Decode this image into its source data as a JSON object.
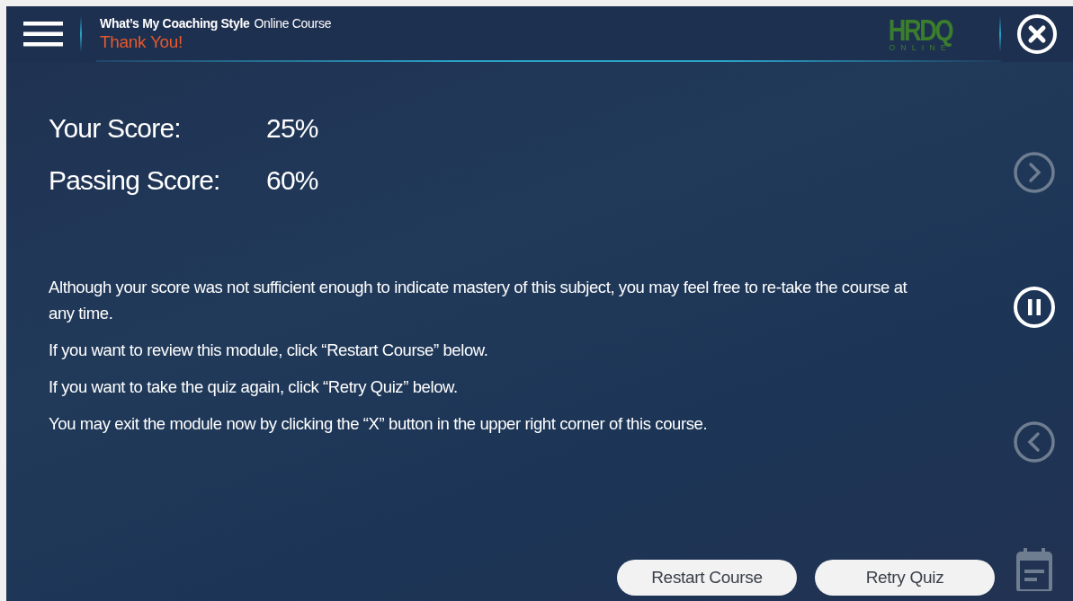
{
  "header": {
    "course_title": "What’s My Coaching Style",
    "course_subtitle": "Online Course",
    "page_title": "Thank You!",
    "logo": {
      "mark": "HRDQ",
      "sub": "ONLINE"
    }
  },
  "scores": [
    {
      "label": "Your Score:",
      "value": "25%"
    },
    {
      "label": "Passing Score:",
      "value": "60%"
    }
  ],
  "paragraphs": [
    "Although your score was not sufficient enough to indicate mastery of this subject, you may feel free to re-take the course at any time.",
    "If you want to review this module, click “Restart Course” below.",
    "If you want to take the quiz again, click “Retry Quiz” below.",
    "You may exit the module now by clicking the “X” button in the upper right corner of this course."
  ],
  "buttons": [
    "Restart Course",
    "Retry Quiz"
  ],
  "side_nav": [
    {
      "kind": "next",
      "disabled": true
    },
    {
      "kind": "pause",
      "disabled": false
    },
    {
      "kind": "previous",
      "disabled": true
    },
    {
      "kind": "notes",
      "disabled": true
    }
  ]
}
